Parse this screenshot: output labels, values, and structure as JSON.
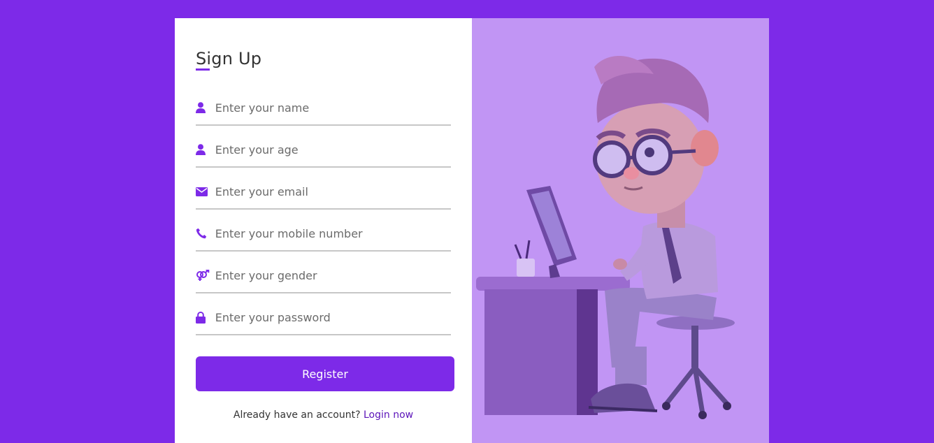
{
  "form": {
    "title": "Sign Up",
    "fields": [
      {
        "icon": "user-icon",
        "placeholder": "Enter your name",
        "value": ""
      },
      {
        "icon": "user-icon",
        "placeholder": "Enter your age",
        "value": ""
      },
      {
        "icon": "envelope-icon",
        "placeholder": "Enter your email",
        "value": ""
      },
      {
        "icon": "phone-icon",
        "placeholder": "Enter your mobile number",
        "value": ""
      },
      {
        "icon": "gender-icon",
        "placeholder": "Enter your gender",
        "value": ""
      },
      {
        "icon": "lock-icon",
        "placeholder": "Enter your password",
        "value": ""
      }
    ],
    "register_label": "Register",
    "login_prompt": "Already have an account?",
    "login_link": "Login now"
  },
  "colors": {
    "accent": "#7d2ae8",
    "illustration_bg": "#c195f4",
    "link": "#5b13b9"
  }
}
